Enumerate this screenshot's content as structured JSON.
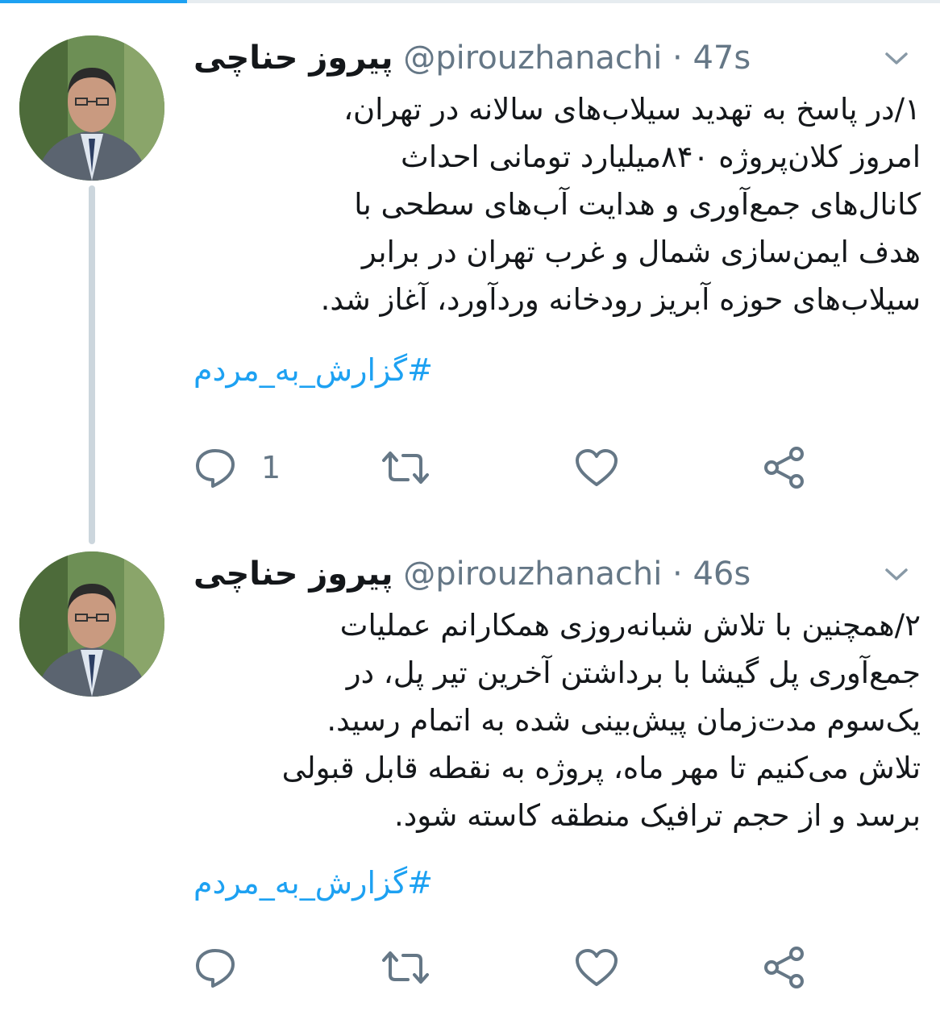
{
  "colors": {
    "accent": "#1da1f2",
    "secondary_text": "#657786",
    "thread_line": "#ccd6dd"
  },
  "tweets": [
    {
      "author_name": "پیروز حناچی",
      "handle": "@pirouzhanachi",
      "separator": "·",
      "time": "47s",
      "lines": [
        "۱/در پاسخ به تهدید سیلاب‌های سالانه در تهران،",
        "امروز کلان‌پروژه ۸۴۰میلیارد تومانی احداث",
        "کانال‌های جمع‌آوری و هدایت آب‌های سطحی با",
        "هدف ایمن‌سازی شمال و غرب تهران در برابر",
        "سیلاب‌های حوزه آبریز رودخانه وردآورد، آغاز شد."
      ],
      "hashtag": "#گزارش_به_مردم",
      "reply_count": "1",
      "icons": [
        "reply-icon",
        "retweet-icon",
        "like-icon",
        "share-icon",
        "chevron-down-icon"
      ]
    },
    {
      "author_name": "پیروز حناچی",
      "handle": "@pirouzhanachi",
      "separator": "·",
      "time": "46s",
      "lines": [
        "۲/همچنین با تلاش شبانه‌روزی همکارانم عملیات",
        "جمع‌آوری پل گیشا با برداشتن آخرین تیر پل، در",
        "یک‌سوم مدت‌زمان پیش‌بینی شده به اتمام رسید.",
        "تلاش می‌کنیم تا مهر ماه، پروژه به نقطه قابل قبولی",
        "برسد و از حجم ترافیک منطقه کاسته شود."
      ],
      "hashtag": "#گزارش_به_مردم",
      "reply_count": "",
      "icons": [
        "reply-icon",
        "retweet-icon",
        "like-icon",
        "share-icon",
        "chevron-down-icon"
      ]
    }
  ]
}
